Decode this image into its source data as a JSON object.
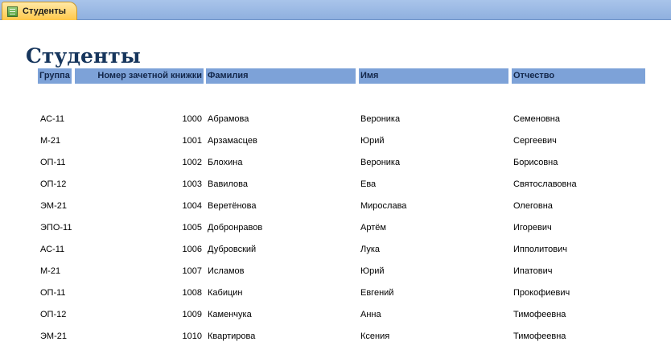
{
  "tab": {
    "label": "Студенты",
    "icon": "report-icon"
  },
  "report": {
    "title": "Студенты",
    "columns": {
      "group": "Группа",
      "record_number": "Номер зачетной книжки",
      "last_name": "Фамилия",
      "first_name": "Имя",
      "middle_name": "Отчество"
    },
    "rows": [
      {
        "group": "АС-11",
        "record_number": "1000",
        "last_name": "Абрамова",
        "first_name": "Вероника",
        "middle_name": "Семеновна"
      },
      {
        "group": "М-21",
        "record_number": "1001",
        "last_name": "Арзамасцев",
        "first_name": "Юрий",
        "middle_name": "Сергеевич"
      },
      {
        "group": "ОП-11",
        "record_number": "1002",
        "last_name": "Блохина",
        "first_name": "Вероника",
        "middle_name": "Борисовна"
      },
      {
        "group": "ОП-12",
        "record_number": "1003",
        "last_name": "Вавилова",
        "first_name": "Ева",
        "middle_name": "Святославовна"
      },
      {
        "group": "ЭМ-21",
        "record_number": "1004",
        "last_name": "Веретёнова",
        "first_name": "Мирослава",
        "middle_name": "Олеговна"
      },
      {
        "group": "ЭПО-11",
        "record_number": "1005",
        "last_name": "Добронравов",
        "first_name": "Артём",
        "middle_name": "Игоревич"
      },
      {
        "group": "АС-11",
        "record_number": "1006",
        "last_name": "Дубровский",
        "first_name": "Лука",
        "middle_name": "Ипполитович"
      },
      {
        "group": "М-21",
        "record_number": "1007",
        "last_name": "Исламов",
        "first_name": "Юрий",
        "middle_name": "Ипатович"
      },
      {
        "group": "ОП-11",
        "record_number": "1008",
        "last_name": "Кабицин",
        "first_name": "Евгений",
        "middle_name": "Прокофиевич"
      },
      {
        "group": "ОП-12",
        "record_number": "1009",
        "last_name": "Каменчука",
        "first_name": "Анна",
        "middle_name": "Тимофеевна"
      },
      {
        "group": "ЭМ-21",
        "record_number": "1010",
        "last_name": "Квартирова",
        "first_name": "Ксения",
        "middle_name": "Тимофеевна"
      }
    ]
  },
  "colors": {
    "tabstrip": "#8fb0df",
    "tab_active": "#ffc84a",
    "header_fill": "#7da2d8",
    "title_text": "#17365d"
  }
}
